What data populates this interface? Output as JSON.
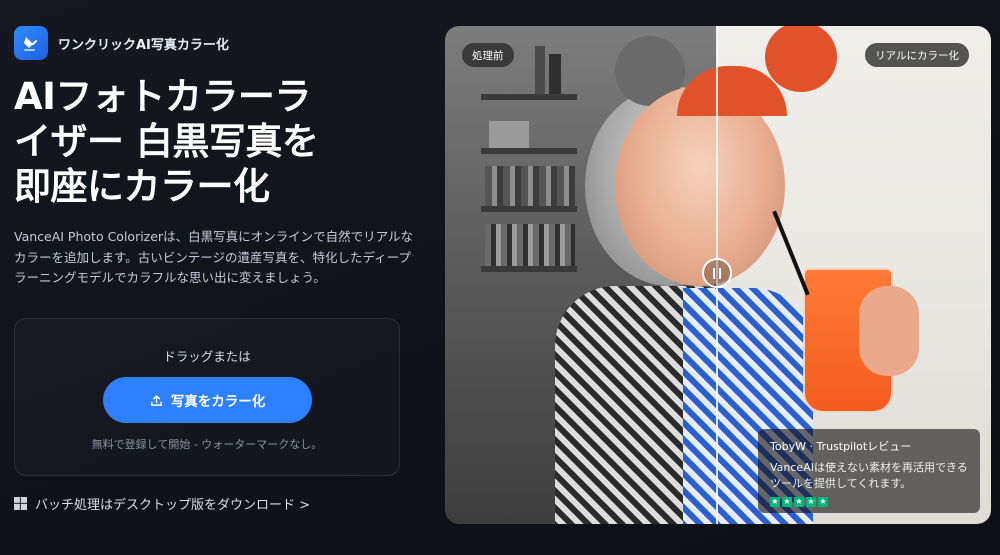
{
  "brand": {
    "name": "ワンクリックAI写真カラー化",
    "logo_icon": "paint-bucket-icon",
    "accent": "#2f80ff"
  },
  "hero": {
    "title": "AIフォトカラーライザー 白黒写真を即座にカラー化",
    "description": "VanceAI Photo Colorizerは、白黒写真にオンラインで自然でリアルなカラーを追加します。古いビンテージの遺産写真を、特化したディープラーニングモデルでカラフルな思い出に変えましょう。"
  },
  "upload": {
    "drag_text": "ドラッグまたは",
    "button_label": "写真をカラー化",
    "button_icon": "upload-icon",
    "note": "無料で登録して開始 - ウォーターマークなし。"
  },
  "desktop_link": {
    "icon": "windows-icon",
    "label": "バッチ処理はデスクトップ版をダウンロード >"
  },
  "compare": {
    "before_label": "処理前",
    "after_label": "リアルにカラー化",
    "handle_icon": "pause-icon",
    "review": {
      "author": "TobyW · Trustpilotレビュー",
      "text": "VanceAIは使えない素材を再活用できるツールを提供してくれます。",
      "rating": 5,
      "star_color": "#00b67a"
    }
  }
}
